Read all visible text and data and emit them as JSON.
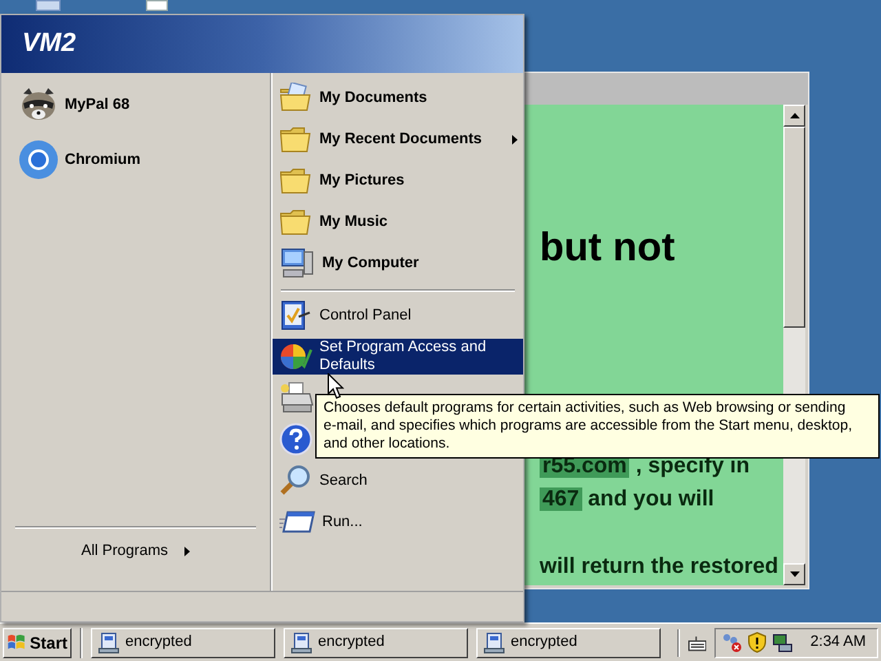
{
  "start_menu": {
    "user": "VM2",
    "pinned": [
      {
        "label": "MyPal 68",
        "kind": "mypal"
      },
      {
        "label": "Chromium",
        "kind": "chromium"
      }
    ],
    "all_programs": "All Programs",
    "places": [
      {
        "label": "My Documents",
        "kind": "documents",
        "submenu": false,
        "selected": false
      },
      {
        "label": "My Recent Documents",
        "kind": "folder",
        "submenu": true,
        "selected": false
      },
      {
        "label": "My Pictures",
        "kind": "folder",
        "submenu": false,
        "selected": false
      },
      {
        "label": "My Music",
        "kind": "folder",
        "submenu": false,
        "selected": false
      },
      {
        "label": "My Computer",
        "kind": "computer",
        "submenu": false,
        "selected": false
      }
    ],
    "system": [
      {
        "label": "Control Panel",
        "kind": "control",
        "selected": false
      },
      {
        "label": "Set Program Access and Defaults",
        "kind": "defaults",
        "selected": true
      },
      {
        "kind": "printer",
        "selected": false
      },
      {
        "kind": "help",
        "selected": false
      },
      {
        "label": "Search",
        "kind": "search",
        "selected": false
      },
      {
        "label": "Run...",
        "kind": "run",
        "selected": false
      }
    ],
    "tooltip": [
      "Chooses default programs for certain activities, such as Web browsing or sending",
      "e-mail, and specifies which programs are accessible from the Start menu, desktop,",
      "and other locations."
    ]
  },
  "document": {
    "heading": "but not",
    "lines": [
      [
        {
          "text": "r55.com",
          "highlight": true
        },
        {
          "text": " , specify in",
          "highlight": false
        }
      ],
      [
        {
          "text": "467",
          "highlight": true
        },
        {
          "text": " and you will",
          "highlight": false
        }
      ],
      [
        {
          "text": "will return the restored",
          "highlight": false
        }
      ]
    ]
  },
  "taskbar": {
    "start": "Start",
    "tasks": [
      {
        "label": "encrypted",
        "selected": false
      },
      {
        "label": "encrypted",
        "selected": false
      },
      {
        "label": "encrypted",
        "selected": false
      }
    ],
    "clock": "2:34 AM"
  }
}
